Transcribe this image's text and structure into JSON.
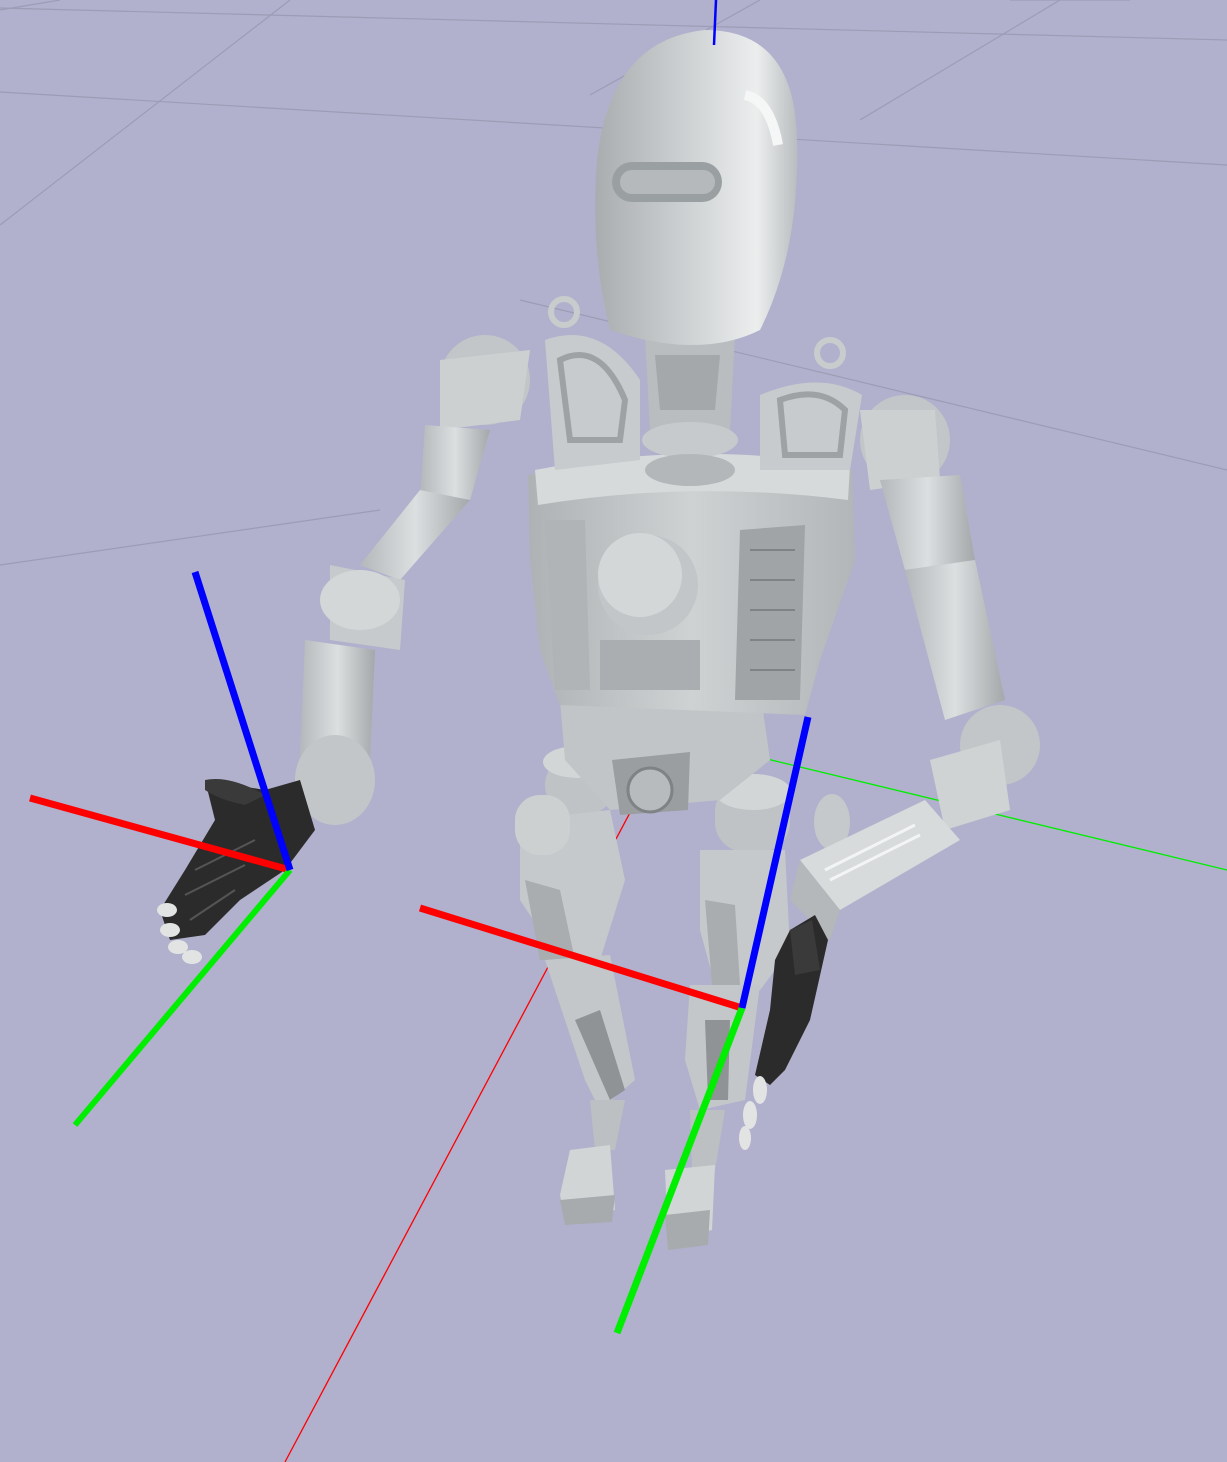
{
  "viewport": {
    "background": "#b1b1cd",
    "grid_color": "#9c9cb6",
    "robot_color": "#c9cccd",
    "robot_shadow": "#9ea2a4",
    "robot_dark": "#7f8385",
    "hand_color": "#2b2b2b"
  },
  "axes": {
    "x_color": "#ff0000",
    "y_color": "#00ee00",
    "z_color": "#0000ff",
    "frames": [
      "world-frame",
      "left-hand-frame",
      "right-foot-frame"
    ]
  }
}
